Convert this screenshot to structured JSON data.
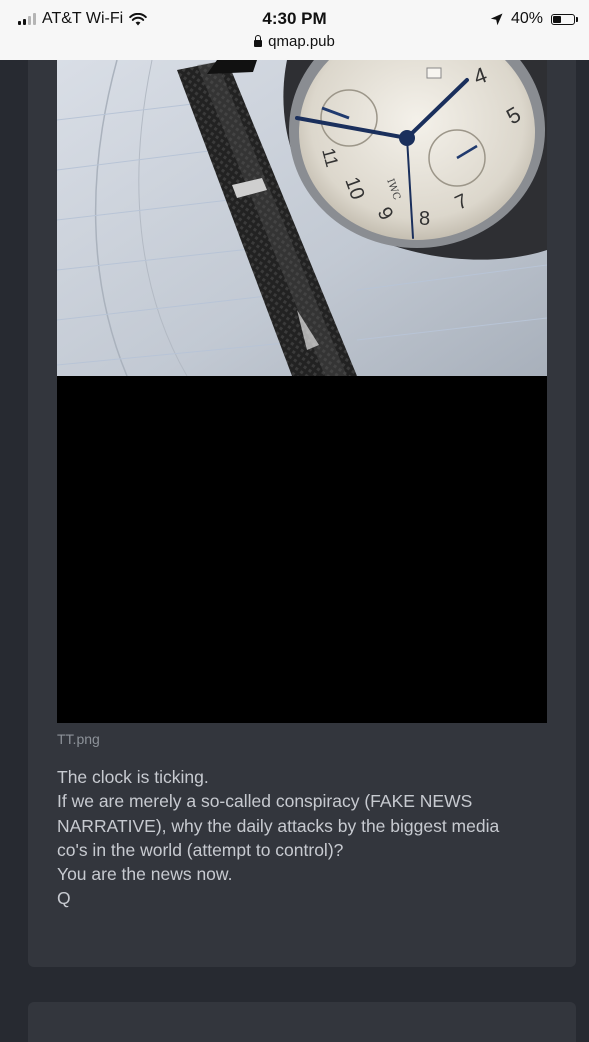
{
  "status_bar": {
    "carrier": "AT&T Wi-Fi",
    "time": "4:30 PM",
    "battery_percent_label": "40%",
    "battery_level": 0.4,
    "signal_icon": "cellular-signal-icon",
    "wifi_icon": "wifi-icon",
    "location_icon": "location-arrow-icon",
    "battery_icon": "battery-icon"
  },
  "browser": {
    "url": "qmap.pub",
    "lock_icon": "lock-icon"
  },
  "post": {
    "image_filename": "TT.png",
    "lines": [
      "The clock is ticking.",
      "If we are merely a so-called conspiracy (FAKE NEWS",
      "NARRATIVE), why the daily attacks by the biggest media",
      "co's in the world (attempt to control)?",
      "You are the news now.",
      "Q"
    ]
  },
  "colors": {
    "page_background": "#272a31",
    "card_background": "#33363d",
    "body_text": "#c7cad0",
    "filename_text": "#8d9299",
    "status_bar_background": "#f7f7f7"
  }
}
